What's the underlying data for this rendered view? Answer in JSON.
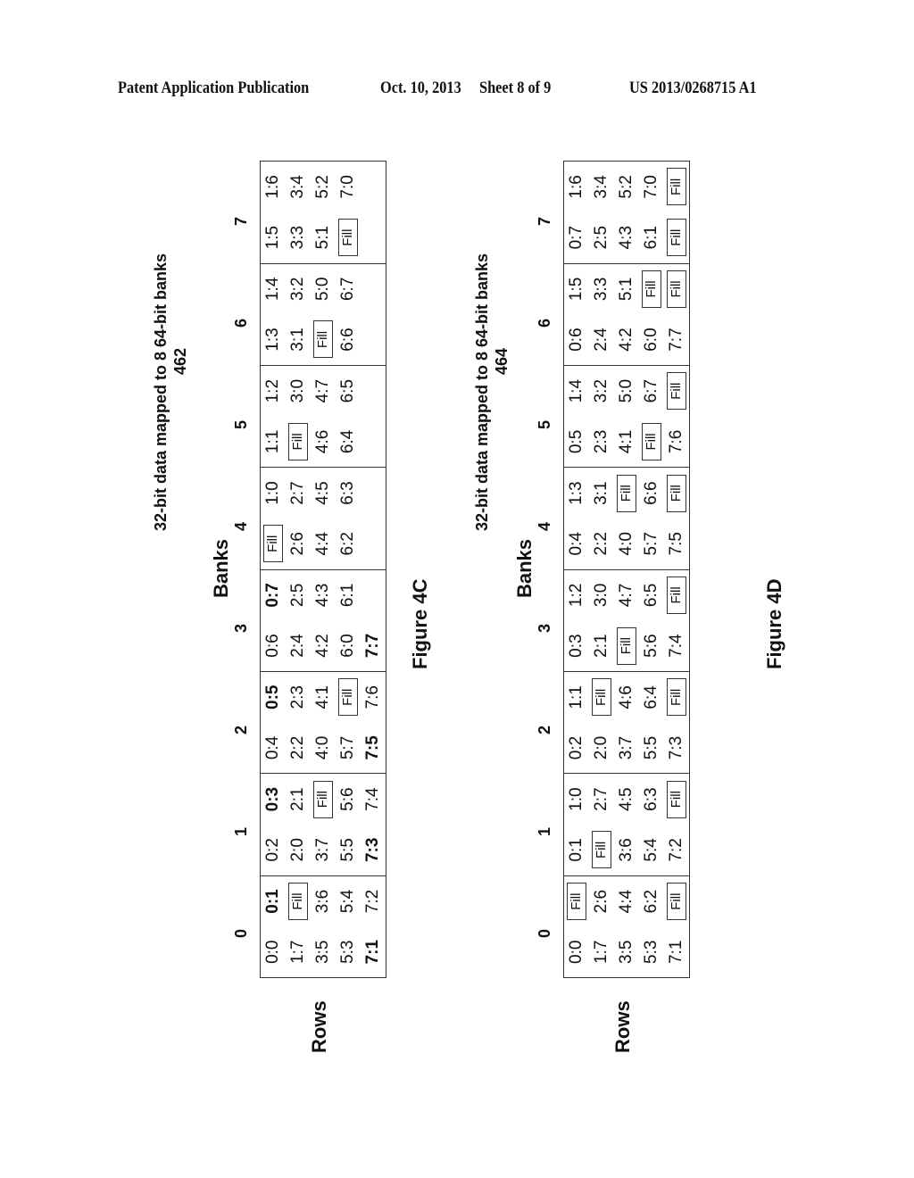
{
  "header": {
    "left": "Patent Application Publication",
    "date": "Oct. 10, 2013",
    "sheet": "Sheet 8 of 9",
    "number": "US 2013/0268715 A1"
  },
  "figures": [
    {
      "caption": "Figure 4C",
      "title": "32-bit data mapped to 8 64-bit banks",
      "ref": "462",
      "axis_rows": "Rows",
      "axis_banks": "Banks",
      "bank_numbers": [
        "0",
        "1",
        "2",
        "3",
        "4",
        "5",
        "6",
        "7"
      ],
      "rows": [
        [
          "0:0",
          "**0:1",
          "0:2",
          "**0:3",
          "0:4",
          "**0:5",
          "0:6",
          "**0:7",
          "Fill",
          "1:0",
          "1:1",
          "1:2",
          "1:3",
          "1:4",
          "1:5",
          "1:6"
        ],
        [
          "1:7",
          "Fill",
          "2:0",
          "2:1",
          "2:2",
          "2:3",
          "2:4",
          "2:5",
          "2:6",
          "2:7",
          "Fill",
          "3:0",
          "3:1",
          "3:2",
          "3:3",
          "3:4"
        ],
        [
          "3:5",
          "3:6",
          "3:7",
          "Fill",
          "4:0",
          "4:1",
          "4:2",
          "4:3",
          "4:4",
          "4:5",
          "4:6",
          "4:7",
          "Fill",
          "5:0",
          "5:1",
          "5:2"
        ],
        [
          "5:3",
          "5:4",
          "5:5",
          "5:6",
          "5:7",
          "Fill",
          "6:0",
          "6:1",
          "6:2",
          "6:3",
          "6:4",
          "6:5",
          "6:6",
          "6:7",
          "Fill",
          "7:0"
        ],
        [
          "**7:1",
          "7:2",
          "**7:3",
          "7:4",
          "**7:5",
          "7:6",
          "**7:7",
          "",
          "",
          "",
          "",
          "",
          "",
          "",
          "",
          ""
        ]
      ]
    },
    {
      "caption": "Figure 4D",
      "title": "32-bit data mapped to 8 64-bit banks",
      "ref": "464",
      "axis_rows": "Rows",
      "axis_banks": "Banks",
      "bank_numbers": [
        "0",
        "1",
        "2",
        "3",
        "4",
        "5",
        "6",
        "7"
      ],
      "rows": [
        [
          "0:0",
          "Fill",
          "0:1",
          "1:0",
          "0:2",
          "1:1",
          "0:3",
          "1:2",
          "0:4",
          "1:3",
          "0:5",
          "1:4",
          "0:6",
          "1:5",
          "0:7",
          "1:6"
        ],
        [
          "1:7",
          "2:6",
          "Fill",
          "2:7",
          "2:0",
          "Fill",
          "2:1",
          "3:0",
          "2:2",
          "3:1",
          "2:3",
          "3:2",
          "2:4",
          "3:3",
          "2:5",
          "3:4"
        ],
        [
          "3:5",
          "4:4",
          "3:6",
          "4:5",
          "3:7",
          "4:6",
          "Fill",
          "4:7",
          "4:0",
          "Fill",
          "4:1",
          "5:0",
          "4:2",
          "5:1",
          "4:3",
          "5:2"
        ],
        [
          "5:3",
          "6:2",
          "5:4",
          "6:3",
          "5:5",
          "6:4",
          "5:6",
          "6:5",
          "5:7",
          "6:6",
          "Fill",
          "6:7",
          "6:0",
          "Fill",
          "6:1",
          "7:0"
        ],
        [
          "7:1",
          "Fill",
          "7:2",
          "Fill",
          "7:3",
          "Fill",
          "7:4",
          "Fill",
          "7:5",
          "Fill",
          "7:6",
          "Fill",
          "7:7",
          "Fill",
          "Fill",
          "Fill"
        ]
      ]
    }
  ]
}
